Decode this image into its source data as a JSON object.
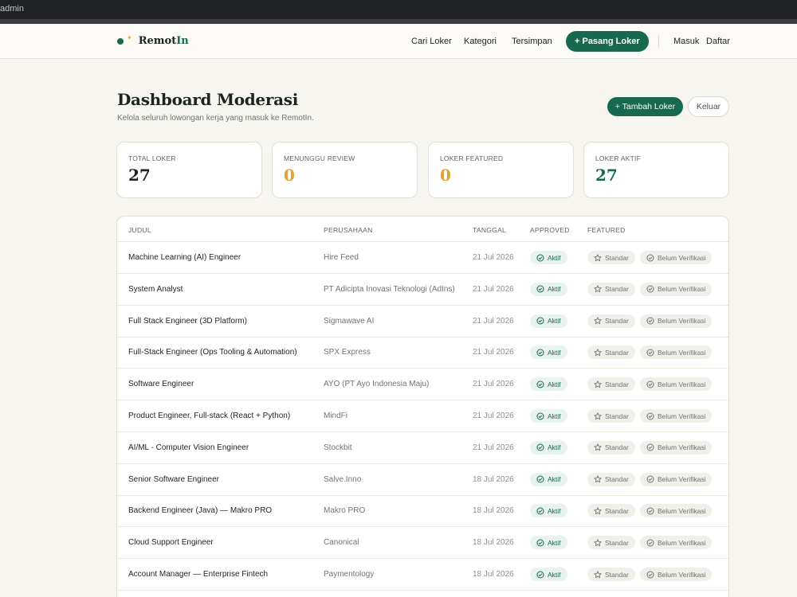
{
  "browser": {
    "title": "admin"
  },
  "nav": {
    "logo_text": "Remot",
    "logo_accent": "In",
    "links": [
      "Cari Loker",
      "Kategori",
      "Tersimpan"
    ],
    "cta": "+ Pasang Loker",
    "login": "Masuk",
    "register": "Daftar"
  },
  "header": {
    "title": "Dashboard Moderasi",
    "subtitle": "Kelola seluruh lowongan kerja yang masuk ke RemotIn.",
    "add_button": "+ Tambah Loker",
    "logout_button": "Keluar"
  },
  "stats": [
    {
      "label": "TOTAL LOKER",
      "value": "27",
      "color": "#1c2420"
    },
    {
      "label": "MENUNGGU REVIEW",
      "value": "0",
      "color": "#e0a232"
    },
    {
      "label": "LOKER FEATURED",
      "value": "0",
      "color": "#e0a232"
    },
    {
      "label": "LOKER AKTIF",
      "value": "27",
      "color": "#17694f"
    }
  ],
  "table": {
    "headers": [
      "JUDUL",
      "PERUSAHAAN",
      "TANGGAL",
      "APPROVED",
      "FEATURED"
    ],
    "rows": [
      {
        "title": "Machine Learning (AI) Engineer",
        "company": "Hire Feed",
        "date": "21 Jul 2026",
        "approved": "Aktif",
        "featured": "Standar",
        "verified": "Belum Verifikasi"
      },
      {
        "title": "System Analyst",
        "company": "PT Adicipta Inovasi Teknologi (AdIns)",
        "date": "21 Jul 2026",
        "approved": "Aktif",
        "featured": "Standar",
        "verified": "Belum Verifikasi"
      },
      {
        "title": "Full Stack Engineer (3D Platform)",
        "company": "Sigmawave AI",
        "date": "21 Jul 2026",
        "approved": "Aktif",
        "featured": "Standar",
        "verified": "Belum Verifikasi"
      },
      {
        "title": "Full-Stack Engineer (Ops Tooling & Automation)",
        "company": "SPX Express",
        "date": "21 Jul 2026",
        "approved": "Aktif",
        "featured": "Standar",
        "verified": "Belum Verifikasi"
      },
      {
        "title": "Software Engineer",
        "company": "AYO (PT Ayo Indonesia Maju)",
        "date": "21 Jul 2026",
        "approved": "Aktif",
        "featured": "Standar",
        "verified": "Belum Verifikasi"
      },
      {
        "title": "Product Engineer, Full-stack (React + Python)",
        "company": "MindFi",
        "date": "21 Jul 2026",
        "approved": "Aktif",
        "featured": "Standar",
        "verified": "Belum Verifikasi"
      },
      {
        "title": "AI/ML - Computer Vision Engineer",
        "company": "Stockbit",
        "date": "21 Jul 2026",
        "approved": "Aktif",
        "featured": "Standar",
        "verified": "Belum Verifikasi"
      },
      {
        "title": "Senior Software Engineer",
        "company": "Salve.Inno",
        "date": "18 Jul 2026",
        "approved": "Aktif",
        "featured": "Standar",
        "verified": "Belum Verifikasi"
      },
      {
        "title": "Backend Engineer (Java) — Makro PRO",
        "company": "Makro PRO",
        "date": "18 Jul 2026",
        "approved": "Aktif",
        "featured": "Standar",
        "verified": "Belum Verifikasi"
      },
      {
        "title": "Cloud Support Engineer",
        "company": "Canonical",
        "date": "18 Jul 2026",
        "approved": "Aktif",
        "featured": "Standar",
        "verified": "Belum Verifikasi"
      },
      {
        "title": "Account Manager — Enterprise Fintech",
        "company": "Paymentology",
        "date": "18 Jul 2026",
        "approved": "Aktif",
        "featured": "Standar",
        "verified": "Belum Verifikasi"
      }
    ]
  },
  "colors": {
    "brand": "#17694f",
    "accent": "#e0a232",
    "background": "#f7f5f0"
  }
}
